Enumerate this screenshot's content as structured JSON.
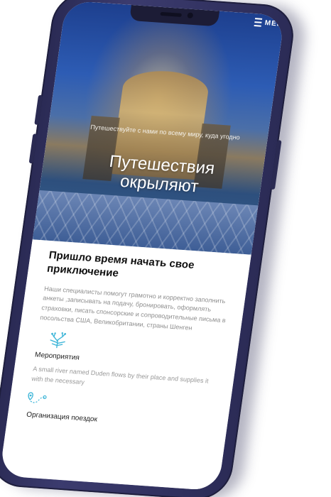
{
  "nav": {
    "menu_label": "МЕНЮ"
  },
  "hero": {
    "subtitle": "Путешествуйте с нами по всему миру, куда угодно",
    "title": "Путешествия окрыляют"
  },
  "intro": {
    "title": "Пришло время начать свое приключение",
    "text": "Наши специалисты помогут грамотно и корректно заполнить анкеты ,записывать на подачу, бронировать, оформлять страховки, писать спонсорские и сопроводительные письма в посольства США, Великобритании, страны Шенген"
  },
  "features": [
    {
      "icon": "coral-icon",
      "title": "Мероприятия",
      "text": "A small river named Duden flows by their place and supplies it with the necessary"
    },
    {
      "icon": "route-map-icon",
      "title": "Организация поездок"
    }
  ],
  "colors": {
    "accent": "#3fb6d8",
    "phone_frame": "#2f2f5e"
  }
}
